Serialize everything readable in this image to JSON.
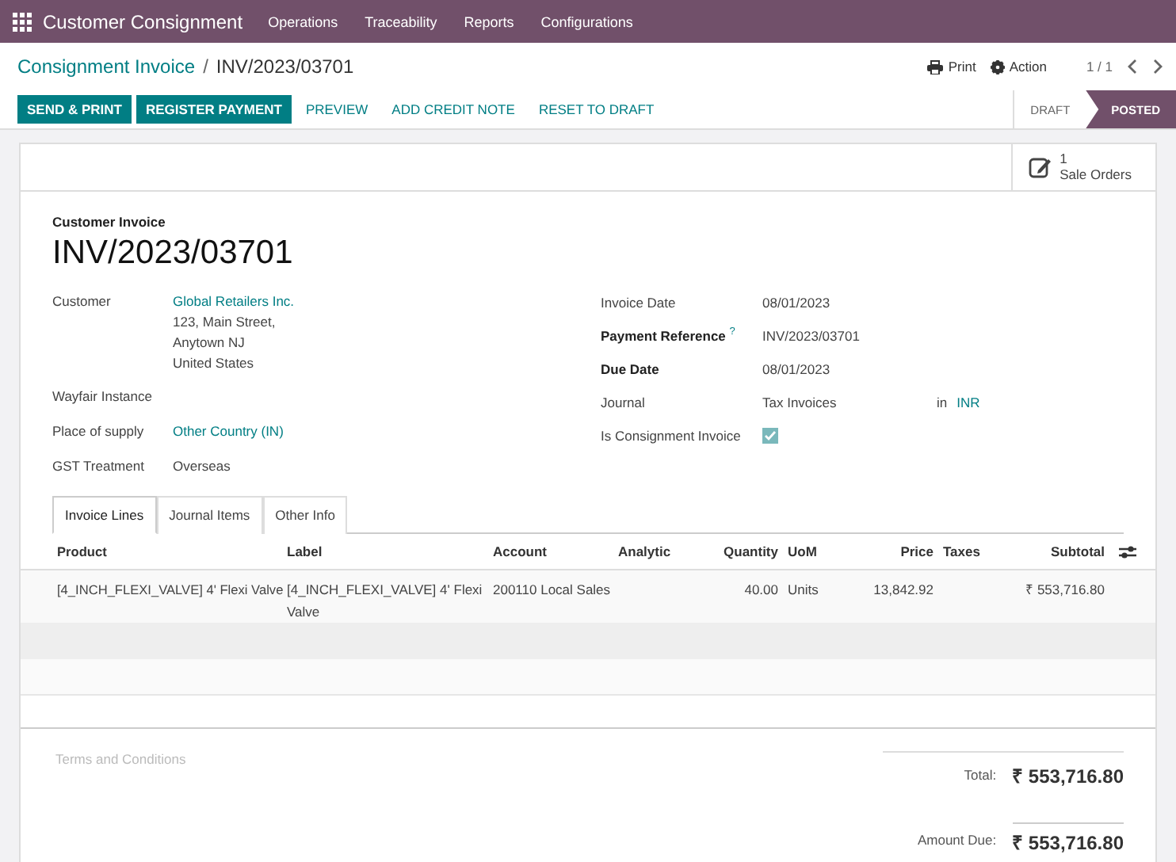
{
  "navbar": {
    "app_name": "Customer Consignment",
    "menus": [
      "Operations",
      "Traceability",
      "Reports",
      "Configurations"
    ]
  },
  "breadcrumb": {
    "parent": "Consignment Invoice",
    "separator": "/",
    "current": "INV/2023/03701"
  },
  "header_actions": {
    "print": "Print",
    "action": "Action",
    "pager": "1 / 1"
  },
  "buttons": [
    {
      "label": "SEND & PRINT",
      "kind": "primary"
    },
    {
      "label": "REGISTER PAYMENT",
      "kind": "primary"
    },
    {
      "label": "PREVIEW",
      "kind": "link"
    },
    {
      "label": "ADD CREDIT NOTE",
      "kind": "link"
    },
    {
      "label": "RESET TO DRAFT",
      "kind": "link"
    }
  ],
  "status_steps": [
    {
      "label": "DRAFT",
      "selected": false
    },
    {
      "label": "POSTED",
      "selected": true
    }
  ],
  "smart_button": {
    "count": "1",
    "label": "Sale Orders"
  },
  "form": {
    "type_label": "Customer Invoice",
    "name": "INV/2023/03701",
    "left_fields": [
      {
        "label": "Customer",
        "value": "Global Retailers Inc.",
        "link": true,
        "address": [
          "123, Main Street,",
          "Anytown NJ",
          "United States"
        ]
      },
      {
        "label": "Wayfair Instance"
      },
      {
        "label": "Place of supply",
        "value": "Other Country (IN)",
        "link": true
      },
      {
        "label": "GST Treatment",
        "value": "Overseas",
        "link": false
      }
    ],
    "right_fields": [
      {
        "label": "Invoice Date",
        "bold": false,
        "kind": "text",
        "value": "08/01/2023"
      },
      {
        "label": "Payment Reference",
        "bold": true,
        "help": "?",
        "kind": "text",
        "value": "INV/2023/03701"
      },
      {
        "label": "Due Date",
        "bold": true,
        "kind": "text",
        "value": "08/01/2023"
      },
      {
        "label": "Journal",
        "bold": false,
        "kind": "journal",
        "value": "Tax Invoices",
        "in": "in",
        "currency": "INR"
      },
      {
        "label": "Is Consignment Invoice",
        "bold": false,
        "kind": "checkbox",
        "checked": true
      }
    ]
  },
  "tabs": [
    {
      "label": "Invoice Lines",
      "selected": true
    },
    {
      "label": "Journal Items",
      "selected": false
    },
    {
      "label": "Other Info",
      "selected": false
    }
  ],
  "table": {
    "columns": [
      "Product",
      "Label",
      "Account",
      "Analytic",
      "Quantity",
      "UoM",
      "Price",
      "Taxes",
      "Subtotal"
    ],
    "rows": [
      {
        "product": "[4_INCH_FLEXI_VALVE] 4' Flexi Valve",
        "label": "[4_INCH_FLEXI_VALVE] 4' Flexi Valve",
        "account": "200110 Local Sales",
        "quantity": "40.00",
        "uom": "Units",
        "price": "13,842.92",
        "subtotal": "₹ 553,716.80"
      }
    ]
  },
  "terms": {
    "placeholder": "Terms and Conditions"
  },
  "totals": {
    "total_label": "Total:",
    "total": "₹ 553,716.80",
    "due_label": "Amount Due:",
    "due": "₹ 553,716.80"
  }
}
